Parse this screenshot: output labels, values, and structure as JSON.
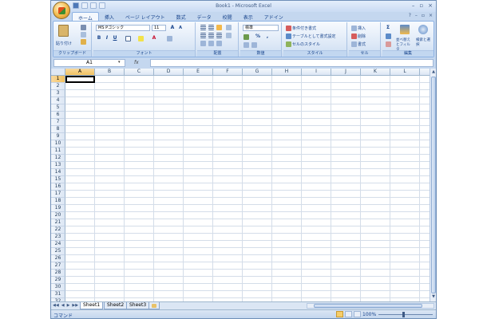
{
  "window": {
    "title": "Book1 - Microsoft Excel",
    "controls": [
      "–",
      "▫",
      "×"
    ]
  },
  "ribbon_tabs": [
    "ホーム",
    "挿入",
    "ページ レイアウト",
    "数式",
    "データ",
    "校閲",
    "表示",
    "アドイン"
  ],
  "ribbon_right": [
    "?",
    "–",
    "▫",
    "×"
  ],
  "groups": {
    "clipboard": {
      "label": "クリップボード",
      "paste": "貼り付け"
    },
    "font": {
      "label": "フォント",
      "font_name": "MS Pゴシック",
      "font_size": "11",
      "bold": "B",
      "italic": "I",
      "underline": "U",
      "grow": "A",
      "shrink": "A",
      "font_color": "A"
    },
    "alignment": {
      "label": "配置"
    },
    "number": {
      "label": "数値",
      "format": "標準",
      "percent": "%",
      "comma": ","
    },
    "styles": {
      "label": "スタイル",
      "conditional": "条件付き書式",
      "table": "テーブルとして書式設定",
      "cell_styles": "セルのスタイル"
    },
    "cells": {
      "label": "セル",
      "insert": "挿入",
      "delete": "削除",
      "format": "書式"
    },
    "editing": {
      "label": "編集",
      "sum": "Σ",
      "sort": "並べ替えとフィルタ",
      "find": "検索と選択"
    }
  },
  "formula_bar": {
    "name_box": "A1",
    "fx": "fx",
    "value": ""
  },
  "columns": [
    "A",
    "B",
    "C",
    "D",
    "E",
    "F",
    "G",
    "H",
    "I",
    "J",
    "K",
    "L",
    "M"
  ],
  "rows": [
    "1",
    "2",
    "3",
    "4",
    "5",
    "6",
    "7",
    "8",
    "9",
    "10",
    "11",
    "12",
    "13",
    "14",
    "15",
    "16",
    "17",
    "18",
    "19",
    "20",
    "21",
    "22",
    "23",
    "24",
    "25",
    "26",
    "27",
    "28",
    "29",
    "30",
    "31",
    "32"
  ],
  "selection": {
    "column": "A",
    "row": "1"
  },
  "sheets": [
    "Sheet1",
    "Sheet2",
    "Sheet3"
  ],
  "active_sheet": "Sheet1",
  "status": {
    "text": "コマンド",
    "zoom": "100%"
  },
  "colors": {
    "frame": "#c4d7ef",
    "accent": "#15428b",
    "selected_header": "#f1c15f"
  }
}
